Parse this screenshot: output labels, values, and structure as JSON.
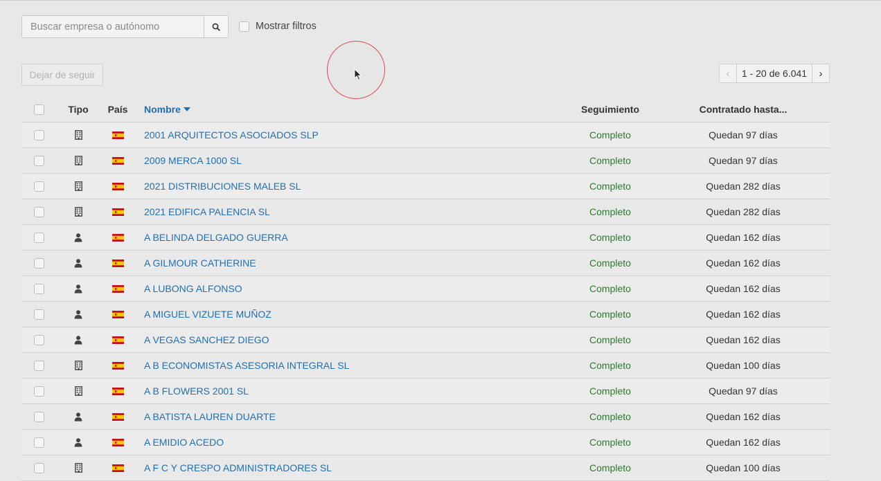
{
  "search": {
    "placeholder": "Buscar empresa o autónomo",
    "value": ""
  },
  "filters": {
    "label": "Mostrar filtros"
  },
  "actions": {
    "unfollow_label": "Dejar de seguir"
  },
  "pagination": {
    "prev": "‹",
    "range": "1 - 20 de 6.041",
    "next": "›"
  },
  "colors": {
    "link": "#1f6fb2",
    "status": "#2c7a2c",
    "cursor_ring": "#e04848"
  },
  "table": {
    "headers": {
      "tipo": "Tipo",
      "pais": "País",
      "nombre": "Nombre",
      "seguimiento": "Seguimiento",
      "contratado": "Contratado hasta..."
    },
    "rows": [
      {
        "tipo": "building-icon",
        "nombre": "2001 ARQUITECTOS ASOCIADOS SLP",
        "seguimiento": "Completo",
        "contratado": "Quedan 97 días"
      },
      {
        "tipo": "building-icon",
        "nombre": "2009 MERCA 1000 SL",
        "seguimiento": "Completo",
        "contratado": "Quedan 97 días"
      },
      {
        "tipo": "building-icon",
        "nombre": "2021 DISTRIBUCIONES MALEB SL",
        "seguimiento": "Completo",
        "contratado": "Quedan 282 días"
      },
      {
        "tipo": "building-icon",
        "nombre": "2021 EDIFICA PALENCIA SL",
        "seguimiento": "Completo",
        "contratado": "Quedan 282 días"
      },
      {
        "tipo": "person-icon",
        "nombre": "A BELINDA DELGADO GUERRA",
        "seguimiento": "Completo",
        "contratado": "Quedan 162 días"
      },
      {
        "tipo": "person-icon",
        "nombre": "A GILMOUR CATHERINE",
        "seguimiento": "Completo",
        "contratado": "Quedan 162 días"
      },
      {
        "tipo": "person-icon",
        "nombre": "A LUBONG ALFONSO",
        "seguimiento": "Completo",
        "contratado": "Quedan 162 días"
      },
      {
        "tipo": "person-icon",
        "nombre": "A MIGUEL VIZUETE MUÑOZ",
        "seguimiento": "Completo",
        "contratado": "Quedan 162 días"
      },
      {
        "tipo": "person-icon",
        "nombre": "A VEGAS SANCHEZ DIEGO",
        "seguimiento": "Completo",
        "contratado": "Quedan 162 días"
      },
      {
        "tipo": "building-icon",
        "nombre": "A B ECONOMISTAS ASESORIA INTEGRAL SL",
        "seguimiento": "Completo",
        "contratado": "Quedan 100 días"
      },
      {
        "tipo": "building-icon",
        "nombre": "A B FLOWERS 2001 SL",
        "seguimiento": "Completo",
        "contratado": "Quedan 97 días"
      },
      {
        "tipo": "person-icon",
        "nombre": "A BATISTA LAUREN DUARTE",
        "seguimiento": "Completo",
        "contratado": "Quedan 162 días"
      },
      {
        "tipo": "person-icon",
        "nombre": "A EMIDIO ACEDO",
        "seguimiento": "Completo",
        "contratado": "Quedan 162 días"
      },
      {
        "tipo": "building-icon",
        "nombre": "A F C Y CRESPO ADMINISTRADORES SL",
        "seguimiento": "Completo",
        "contratado": "Quedan 100 días"
      }
    ]
  }
}
